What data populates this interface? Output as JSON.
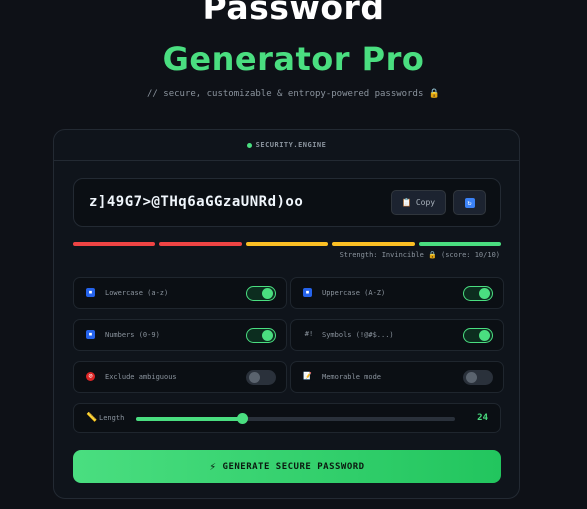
{
  "header": {
    "title_line1": "Password",
    "title_line2": "Generator Pro",
    "subtitle": "// secure, customizable & entropy-powered passwords 🔒"
  },
  "card": {
    "engine_label": "SECURITY.ENGINE",
    "password": "z]49G7>@THq6aGGzaUNRd)oo",
    "copy_label": "Copy",
    "copy_icon": "📋",
    "regen_icon": "🔄",
    "strength": {
      "text": "Strength: Invincible 🔒 (score: 10/10)",
      "segment_colors": [
        "#ef4444",
        "#ef4444",
        "#fbbf24",
        "#fbbf24",
        "#4ade80"
      ]
    },
    "options": [
      {
        "label": "Lowercase (a-z)",
        "icon": "▪",
        "icon_color": "#2563eb",
        "enabled": true
      },
      {
        "label": "Uppercase (A-Z)",
        "icon": "▪",
        "icon_color": "#2563eb",
        "enabled": true
      },
      {
        "label": "Numbers (0-9)",
        "icon": "▪",
        "icon_color": "#2563eb",
        "enabled": true
      },
      {
        "label": "Symbols (!@#$...)",
        "icon": "#!",
        "icon_color": "#0b0f14",
        "enabled": true
      },
      {
        "label": "Exclude ambiguous",
        "icon": "⊘",
        "icon_color": "#dc2626",
        "enabled": false
      },
      {
        "label": "Memorable mode",
        "icon": "📝",
        "icon_color": "#0b0f14",
        "enabled": false
      }
    ],
    "length": {
      "label": "Length",
      "value": "24",
      "min": 4,
      "max": 64,
      "current": 24
    },
    "generate_label": "GENERATE SECURE PASSWORD",
    "generate_icon": "⚡"
  }
}
